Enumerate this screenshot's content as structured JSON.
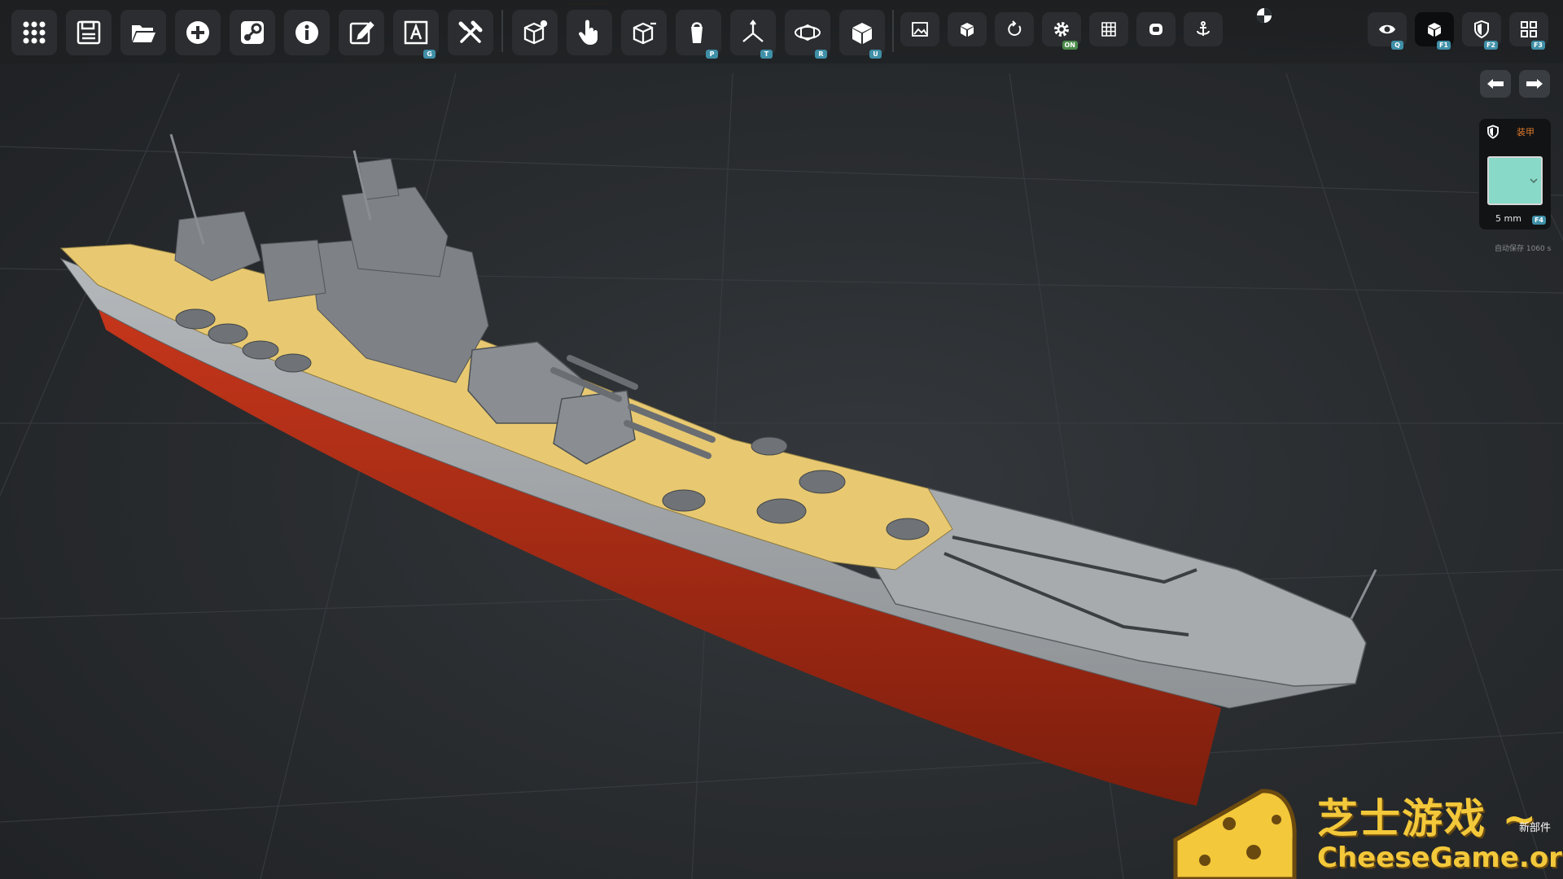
{
  "toolbar": {
    "left_tools": [
      {
        "icon": "grid-menu-icon"
      },
      {
        "icon": "save-icon"
      },
      {
        "icon": "open-folder-icon"
      },
      {
        "icon": "add-circle-icon"
      },
      {
        "icon": "steam-icon"
      },
      {
        "icon": "info-icon"
      },
      {
        "icon": "edit-icon"
      },
      {
        "icon": "text-a-icon",
        "badge": "G"
      },
      {
        "icon": "tools-icon"
      }
    ],
    "mode_tools": [
      {
        "icon": "add-part-cube-icon"
      },
      {
        "icon": "hand-select-icon"
      },
      {
        "icon": "remove-part-cube-icon"
      },
      {
        "icon": "paint-bucket-icon",
        "badge": "P"
      },
      {
        "icon": "move-axes-icon",
        "badge": "T"
      },
      {
        "icon": "rotate-cube-icon",
        "badge": "R"
      },
      {
        "icon": "solid-cube-icon",
        "badge": "U"
      }
    ],
    "small_tools": [
      {
        "icon": "image-icon"
      },
      {
        "icon": "small-cube-icon"
      },
      {
        "icon": "refresh-icon"
      },
      {
        "icon": "gear-icon",
        "badge": "ON"
      },
      {
        "icon": "grid-icon"
      },
      {
        "icon": "record-icon"
      },
      {
        "icon": "anchor-icon"
      }
    ],
    "right_tools": [
      {
        "icon": "eye-icon",
        "badge": "Q"
      },
      {
        "icon": "cube-view-icon",
        "badge": "F1",
        "active": true
      },
      {
        "icon": "armor-shield-icon",
        "badge": "F2"
      },
      {
        "icon": "layout-grid-icon",
        "badge": "F3"
      }
    ]
  },
  "nav": {
    "back_icon": "arrow-left-icon",
    "forward_icon": "arrow-right-icon"
  },
  "armor_panel": {
    "title": "装甲",
    "thickness": "5 mm",
    "badge": "F4",
    "color": "#88d9c7"
  },
  "autosave": "自动保存 1060 s",
  "watermark": {
    "cn": "芝士游戏 ~",
    "en": "CheeseGame.org"
  },
  "new_part_label": "新部件",
  "colors": {
    "deck": "#e8c971",
    "hull": "#a9adb0",
    "hull_bottom": "#b6301a",
    "superstructure": "#7f8388",
    "background": "#2a2d30",
    "accent": "#e8711d"
  }
}
